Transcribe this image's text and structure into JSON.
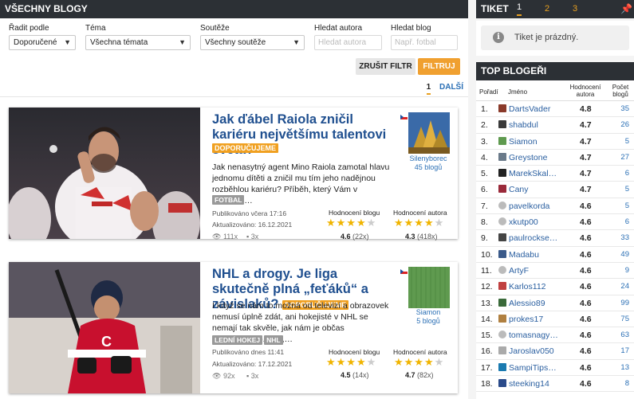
{
  "header": {
    "title": "VŠECHNY BLOGY"
  },
  "filters": {
    "sort": {
      "label": "Řadit podle",
      "value": "Doporučené"
    },
    "topic": {
      "label": "Téma",
      "value": "Všechna témata"
    },
    "contest": {
      "label": "Soutěže",
      "value": "Všechny soutěže"
    },
    "author": {
      "label": "Hledat autora",
      "placeholder": "Hledat autora"
    },
    "blog": {
      "label": "Hledat blog",
      "placeholder": "Např. fotbal"
    },
    "reset_label": "ZRUŠIT FILTR",
    "filter_label": "FILTRUJ"
  },
  "pager": {
    "current": "1",
    "next": "DALŠÍ"
  },
  "posts": [
    {
      "title": "Jak ďábel Raiola zničil kariéru největšímu talentovi světa?",
      "badge": "DOPORUČUJEME",
      "text": "Jak nenasytný agent Mino Raiola zamotal hlavu jednomu dítěti a zničil mu tím jeho nadějnou rozběhlou kariéru? Příběh, který Vám v dnešním…",
      "tags": [
        "FOTBAL"
      ],
      "published": "Publikováno včera 17:16",
      "updated": "Aktualizováno: 16.12.2021",
      "views": "111x",
      "comments": "3x",
      "blog_rating_label": "Hodnocení blogu",
      "author_rating_label": "Hodnocení autora",
      "blog_rating": "4.6",
      "blog_votes": "(22x)",
      "author_rating": "4.3",
      "author_votes": "(418x)",
      "blog_stars": 4.6,
      "author_stars": 4.3,
      "author": "Silenyborec",
      "author_blogs": "45 blogů"
    },
    {
      "title": "NHL a drogy. Je liga skutečně plná „feťáků“ a závislaků?",
      "badge": "DOPORUČUJEME",
      "text": "I když se nám to možná od televizí a obrazovek nemusí úplně zdát, ani hokejisté v NHL se nemají tak skvěle, jak nám je občas prezentováno. Ano,…",
      "tags": [
        "LEDNÍ HOKEJ",
        "NHL"
      ],
      "published": "Publikováno dnes 11:41",
      "updated": "Aktualizováno: 17.12.2021",
      "views": "92x",
      "comments": "3x",
      "blog_rating_label": "Hodnocení blogu",
      "author_rating_label": "Hodnocení autora",
      "blog_rating": "4.5",
      "blog_votes": "(14x)",
      "author_rating": "4.7",
      "author_votes": "(82x)",
      "blog_stars": 4.5,
      "author_stars": 4.7,
      "author": "Siamon",
      "author_blogs": "5 blogů"
    }
  ],
  "ticket": {
    "title": "TIKET",
    "tabs": [
      "1",
      "2",
      "3"
    ],
    "empty": "Tiket je prázdný."
  },
  "top": {
    "title": "TOP BLOGEŘI",
    "col_rank": "Pořadí",
    "col_name": "Jméno",
    "col_score": "Hodnocení autora",
    "col_count": "Počet blogů",
    "rows": [
      {
        "rank": "1.",
        "name": "DartsVader",
        "score": "4.8",
        "count": "35"
      },
      {
        "rank": "2.",
        "name": "shabdul",
        "score": "4.7",
        "count": "26"
      },
      {
        "rank": "3.",
        "name": "Siamon",
        "score": "4.7",
        "count": "5"
      },
      {
        "rank": "4.",
        "name": "Greystone",
        "score": "4.7",
        "count": "27"
      },
      {
        "rank": "5.",
        "name": "MarekSkal…",
        "score": "4.7",
        "count": "6"
      },
      {
        "rank": "6.",
        "name": "Cany",
        "score": "4.7",
        "count": "5"
      },
      {
        "rank": "7.",
        "name": "pavelkorda",
        "score": "4.6",
        "count": "5"
      },
      {
        "rank": "8.",
        "name": "xkutp00",
        "score": "4.6",
        "count": "6"
      },
      {
        "rank": "9.",
        "name": "paulrockse…",
        "score": "4.6",
        "count": "33"
      },
      {
        "rank": "10.",
        "name": "Madabu",
        "score": "4.6",
        "count": "49"
      },
      {
        "rank": "11.",
        "name": "ArtyF",
        "score": "4.6",
        "count": "9"
      },
      {
        "rank": "12.",
        "name": "Karlos112",
        "score": "4.6",
        "count": "24"
      },
      {
        "rank": "13.",
        "name": "Alessio89",
        "score": "4.6",
        "count": "99"
      },
      {
        "rank": "14.",
        "name": "prokes17",
        "score": "4.6",
        "count": "75"
      },
      {
        "rank": "15.",
        "name": "tomasnagy…",
        "score": "4.6",
        "count": "63"
      },
      {
        "rank": "16.",
        "name": "Jaroslav050",
        "score": "4.6",
        "count": "17"
      },
      {
        "rank": "17.",
        "name": "SampiTips…",
        "score": "4.6",
        "count": "13"
      },
      {
        "rank": "18.",
        "name": "steeking14",
        "score": "4.6",
        "count": "8"
      }
    ]
  },
  "colors": {
    "accent": "#f0a020",
    "link": "#2a6fb5",
    "header": "#2c3035"
  }
}
